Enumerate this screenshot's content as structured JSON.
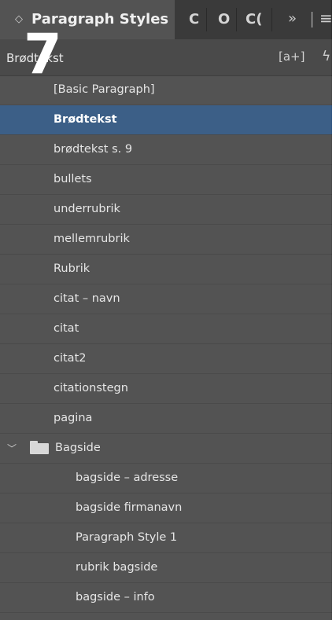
{
  "tabs": {
    "active_label": "Paragraph Styles",
    "others": [
      "C",
      "O",
      "C("
    ],
    "overflow": "»",
    "menu": "≡"
  },
  "badge": "7",
  "header": {
    "current_style": "Brødtekst",
    "new_style_icon": "[a+]",
    "lightning_icon": "ϟ"
  },
  "styles": [
    {
      "label": "[Basic Paragraph]",
      "selected": false
    },
    {
      "label": "Brødtekst",
      "selected": true
    },
    {
      "label": "brødtekst s. 9",
      "selected": false
    },
    {
      "label": "bullets",
      "selected": false
    },
    {
      "label": "underrubrik",
      "selected": false
    },
    {
      "label": "mellemrubrik",
      "selected": false
    },
    {
      "label": "Rubrik",
      "selected": false
    },
    {
      "label": "citat – navn",
      "selected": false
    },
    {
      "label": "citat",
      "selected": false
    },
    {
      "label": "citat2",
      "selected": false
    },
    {
      "label": "citationstegn",
      "selected": false
    },
    {
      "label": "pagina",
      "selected": false
    }
  ],
  "group": {
    "label": "Bagside",
    "items": [
      {
        "label": "bagside – adresse"
      },
      {
        "label": "bagside firmanavn"
      },
      {
        "label": "Paragraph Style 1"
      },
      {
        "label": "rubrik bagside"
      },
      {
        "label": "bagside – info"
      }
    ]
  }
}
